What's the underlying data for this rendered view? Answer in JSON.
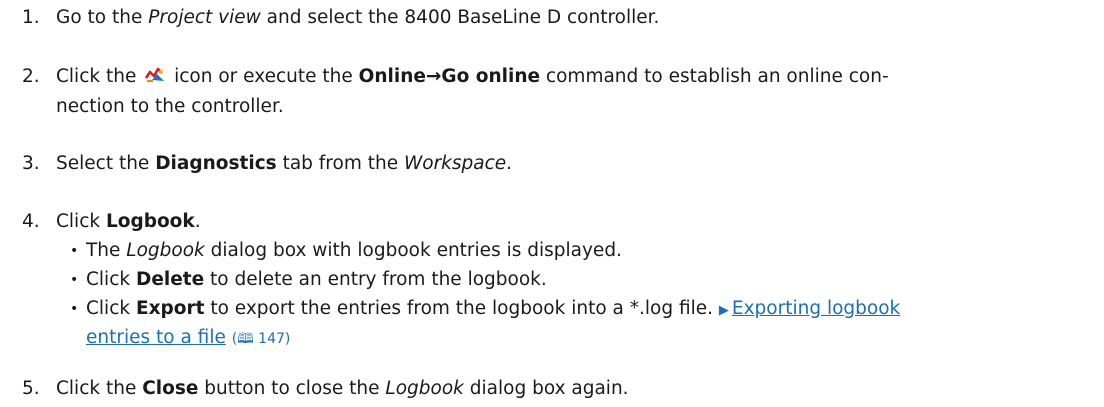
{
  "steps": [
    {
      "number": "1.",
      "t1": "Go to the ",
      "t2": "Project view",
      "t3": " and select the 8400 BaseLine D controller."
    },
    {
      "number": "2.",
      "t1": "Click the ",
      "icon": "go-online-icon",
      "t2": " icon or execute the ",
      "t3": "Online→Go online",
      "t4": " command to establish an online con-",
      "line2": "nection to the controller."
    },
    {
      "number": "3.",
      "t1": "Select the ",
      "t2": "Diagnostics",
      "t3": " tab from the ",
      "t4": "Workspace",
      "t5": "."
    },
    {
      "number": "4.",
      "t1": "Click ",
      "t2": "Logbook",
      "t3": ".",
      "bullets": [
        {
          "t1": "The ",
          "t2": "Logbook",
          "t3": " dialog box with logbook entries is displayed."
        },
        {
          "t1": "Click ",
          "t2": "Delete",
          "t3": " to delete an entry from the logbook."
        },
        {
          "t1": "Click ",
          "t2": "Export",
          "t3": " to export the entries from the logbook into a *.log file. ",
          "link_marker": "▶",
          "link_line1": "Exporting logbook",
          "link_line2": "entries to a file",
          "ref": "(🕮 147)"
        }
      ]
    },
    {
      "number": "5.",
      "t1": "Click the ",
      "t2": "Close",
      "t3": " button to close the ",
      "t4": "Logbook",
      "t5": " dialog box again."
    }
  ],
  "colors": {
    "text": "#1a1a1a",
    "link": "#1a6fb5"
  }
}
